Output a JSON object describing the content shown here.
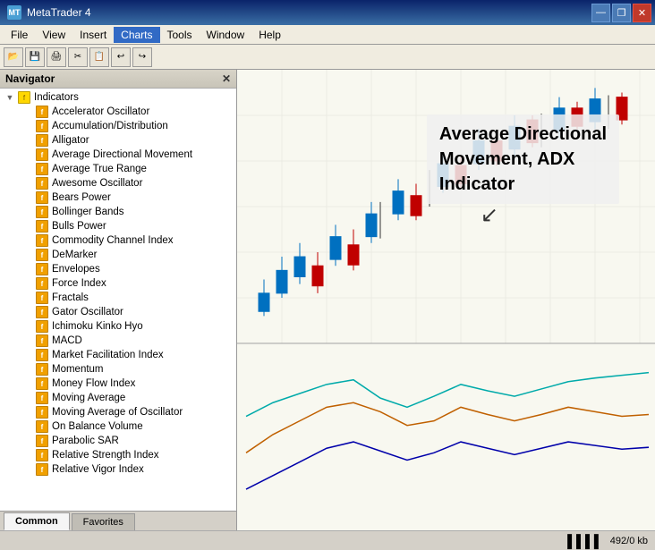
{
  "titleBar": {
    "appName": "MetaTrader 4",
    "controls": {
      "minimize": "—",
      "maximize": "❐",
      "close": "✕"
    }
  },
  "menuBar": {
    "items": [
      "File",
      "View",
      "Insert",
      "Charts",
      "Tools",
      "Window",
      "Help"
    ],
    "active": "Charts"
  },
  "navigator": {
    "title": "Navigator",
    "tree": {
      "root": "Indicators",
      "items": [
        "Accelerator Oscillator",
        "Accumulation/Distribution",
        "Alligator",
        "Average Directional Movement",
        "Average True Range",
        "Awesome Oscillator",
        "Bears Power",
        "Bollinger Bands",
        "Bulls Power",
        "Commodity Channel Index",
        "DeMarker",
        "Envelopes",
        "Force Index",
        "Fractals",
        "Gator Oscillator",
        "Ichimoku Kinko Hyo",
        "MACD",
        "Market Facilitation Index",
        "Momentum",
        "Money Flow Index",
        "Moving Average",
        "Moving Average of Oscillator",
        "On Balance Volume",
        "Parabolic SAR",
        "Relative Strength Index",
        "Relative Vigor Index"
      ]
    }
  },
  "tabs": {
    "common": "Common",
    "favorites": "Favorites"
  },
  "chart": {
    "label": {
      "line1": "Average Directional",
      "line2": "Movement, ADX",
      "line3": "Indicator"
    }
  },
  "statusBar": {
    "memory": "492/0 kb"
  }
}
